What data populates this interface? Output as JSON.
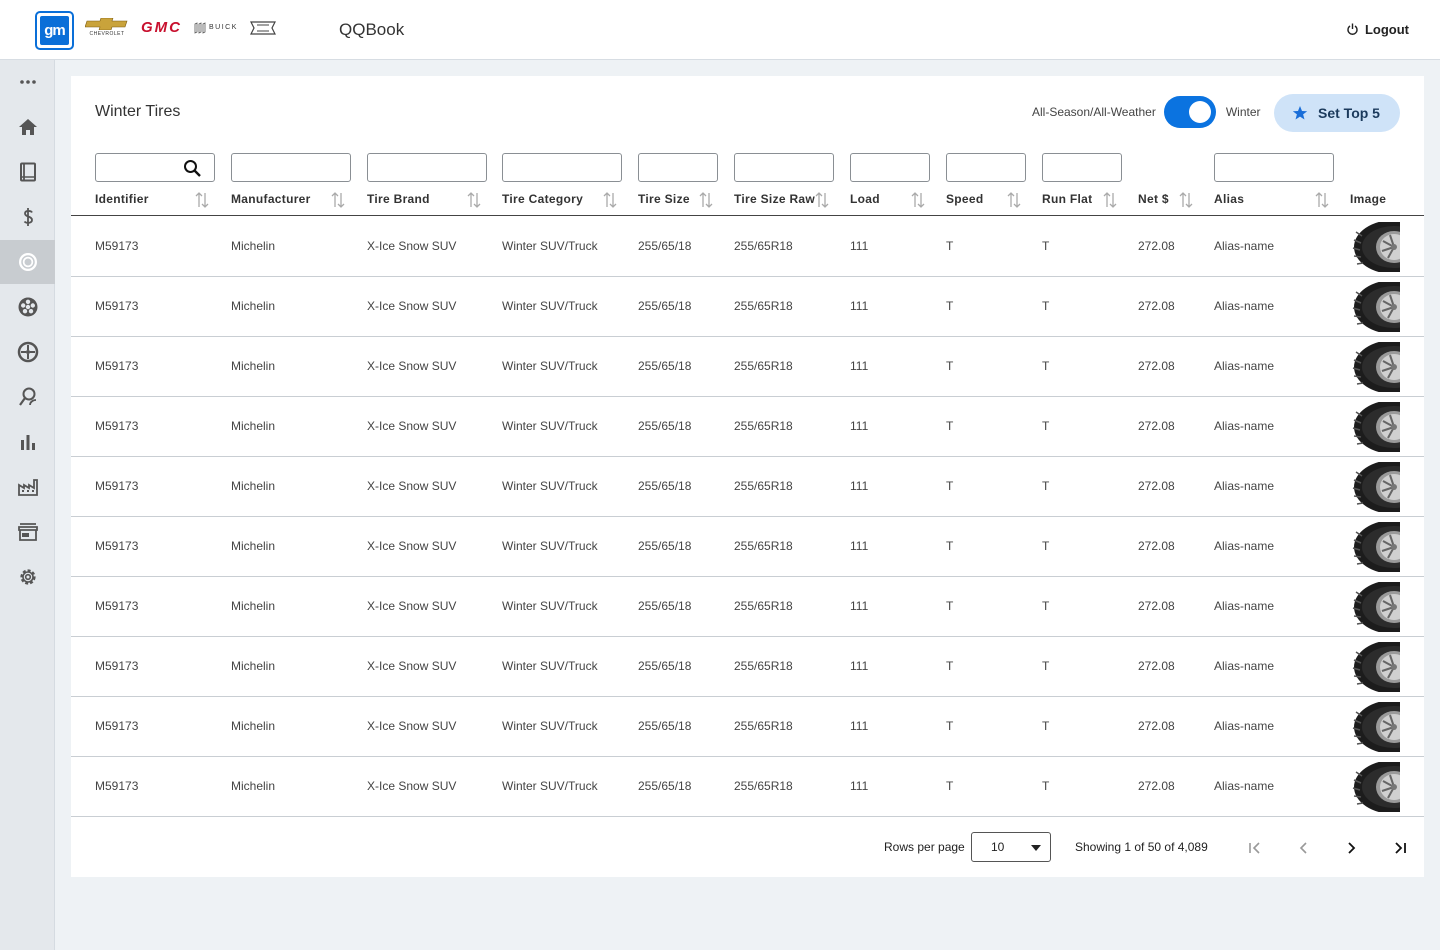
{
  "header": {
    "logo_text": "gm",
    "brands": {
      "chevrolet": "CHEVROLET",
      "gmc": "GMC",
      "buick": "BUICK",
      "cadillac": "CADILLAC"
    },
    "app_title": "QQBook",
    "logout_label": "Logout"
  },
  "sidebar": {
    "items": [
      {
        "name": "more-icon"
      },
      {
        "name": "home-icon"
      },
      {
        "name": "book-icon"
      },
      {
        "name": "dollar-icon"
      },
      {
        "name": "tire-icon",
        "active": true
      },
      {
        "name": "wheel-icon"
      },
      {
        "name": "rim-icon"
      },
      {
        "name": "search-person-icon"
      },
      {
        "name": "bar-chart-icon"
      },
      {
        "name": "factory-icon"
      },
      {
        "name": "store-icon"
      },
      {
        "name": "settings-icon"
      }
    ]
  },
  "page": {
    "title": "Winter Tires",
    "toggle_left": "All-Season/All-Weather",
    "toggle_right": "Winter",
    "toggle_on": true,
    "set_top_label": "Set Top 5"
  },
  "table": {
    "columns": [
      {
        "key": "identifier",
        "label": "Identifier"
      },
      {
        "key": "manufacturer",
        "label": "Manufacturer"
      },
      {
        "key": "brand",
        "label": "Tire Brand"
      },
      {
        "key": "category",
        "label": "Tire Category"
      },
      {
        "key": "size",
        "label": "Tire Size"
      },
      {
        "key": "size_raw",
        "label": "Tire Size Raw"
      },
      {
        "key": "load",
        "label": "Load"
      },
      {
        "key": "speed",
        "label": "Speed"
      },
      {
        "key": "run_flat",
        "label": "Run Flat"
      },
      {
        "key": "net",
        "label": "Net $"
      },
      {
        "key": "alias",
        "label": "Alias"
      },
      {
        "key": "image",
        "label": "Image"
      }
    ],
    "rows": [
      {
        "identifier": "M59173",
        "manufacturer": "Michelin",
        "brand": "X-Ice Snow SUV",
        "category": "Winter SUV/Truck",
        "size": "255/65/18",
        "size_raw": "255/65R18",
        "load": "111",
        "speed": "T",
        "run_flat": "T",
        "net": "272.08",
        "alias": "Alias-name"
      },
      {
        "identifier": "M59173",
        "manufacturer": "Michelin",
        "brand": "X-Ice Snow SUV",
        "category": "Winter SUV/Truck",
        "size": "255/65/18",
        "size_raw": "255/65R18",
        "load": "111",
        "speed": "T",
        "run_flat": "T",
        "net": "272.08",
        "alias": "Alias-name"
      },
      {
        "identifier": "M59173",
        "manufacturer": "Michelin",
        "brand": "X-Ice Snow SUV",
        "category": "Winter SUV/Truck",
        "size": "255/65/18",
        "size_raw": "255/65R18",
        "load": "111",
        "speed": "T",
        "run_flat": "T",
        "net": "272.08",
        "alias": "Alias-name"
      },
      {
        "identifier": "M59173",
        "manufacturer": "Michelin",
        "brand": "X-Ice Snow SUV",
        "category": "Winter SUV/Truck",
        "size": "255/65/18",
        "size_raw": "255/65R18",
        "load": "111",
        "speed": "T",
        "run_flat": "T",
        "net": "272.08",
        "alias": "Alias-name"
      },
      {
        "identifier": "M59173",
        "manufacturer": "Michelin",
        "brand": "X-Ice Snow SUV",
        "category": "Winter SUV/Truck",
        "size": "255/65/18",
        "size_raw": "255/65R18",
        "load": "111",
        "speed": "T",
        "run_flat": "T",
        "net": "272.08",
        "alias": "Alias-name"
      },
      {
        "identifier": "M59173",
        "manufacturer": "Michelin",
        "brand": "X-Ice Snow SUV",
        "category": "Winter SUV/Truck",
        "size": "255/65/18",
        "size_raw": "255/65R18",
        "load": "111",
        "speed": "T",
        "run_flat": "T",
        "net": "272.08",
        "alias": "Alias-name"
      },
      {
        "identifier": "M59173",
        "manufacturer": "Michelin",
        "brand": "X-Ice Snow SUV",
        "category": "Winter SUV/Truck",
        "size": "255/65/18",
        "size_raw": "255/65R18",
        "load": "111",
        "speed": "T",
        "run_flat": "T",
        "net": "272.08",
        "alias": "Alias-name"
      },
      {
        "identifier": "M59173",
        "manufacturer": "Michelin",
        "brand": "X-Ice Snow SUV",
        "category": "Winter SUV/Truck",
        "size": "255/65/18",
        "size_raw": "255/65R18",
        "load": "111",
        "speed": "T",
        "run_flat": "T",
        "net": "272.08",
        "alias": "Alias-name"
      },
      {
        "identifier": "M59173",
        "manufacturer": "Michelin",
        "brand": "X-Ice Snow SUV",
        "category": "Winter SUV/Truck",
        "size": "255/65/18",
        "size_raw": "255/65R18",
        "load": "111",
        "speed": "T",
        "run_flat": "T",
        "net": "272.08",
        "alias": "Alias-name"
      },
      {
        "identifier": "M59173",
        "manufacturer": "Michelin",
        "brand": "X-Ice Snow SUV",
        "category": "Winter SUV/Truck",
        "size": "255/65/18",
        "size_raw": "255/65R18",
        "load": "111",
        "speed": "T",
        "run_flat": "T",
        "net": "272.08",
        "alias": "Alias-name"
      }
    ]
  },
  "pagination": {
    "rows_per_page_label": "Rows per page",
    "rows_per_page_value": "10",
    "showing_text": "Showing 1 of 50 of 4,089"
  },
  "colors": {
    "accent": "#0b73e0",
    "button_bg": "#cfe3f8",
    "sidebar_bg": "#e4e8ec",
    "page_bg": "#eef2f5"
  }
}
